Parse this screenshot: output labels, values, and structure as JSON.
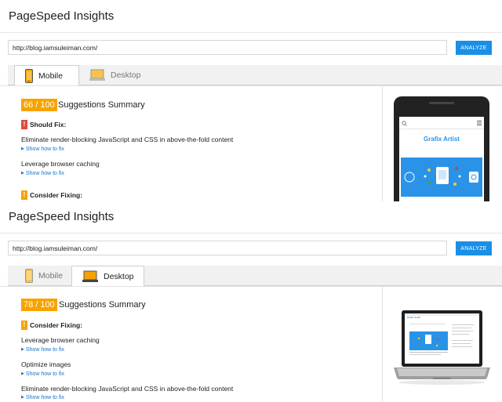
{
  "panels": [
    {
      "title": "PageSpeed Insights",
      "url_value": "http://blog.iamsuleiman.com/",
      "analyze_label": "ANALYZE",
      "tabs": [
        {
          "label": "Mobile",
          "icon": "mobile-icon",
          "active": true
        },
        {
          "label": "Desktop",
          "icon": "desktop-icon",
          "active": false
        }
      ],
      "score": "66 / 100",
      "summary_title": "Suggestions Summary",
      "should_fix": {
        "heading": "Should Fix:",
        "flag_icon": "!",
        "color": "#dd4b39",
        "items": [
          {
            "title": "Eliminate render-blocking JavaScript and CSS in above-the-fold content",
            "link": "Show how to fix"
          },
          {
            "title": "Leverage browser caching",
            "link": "Show how to fix"
          }
        ]
      },
      "consider_fixing": {
        "heading": "Consider Fixing:",
        "flag_icon": "!",
        "color": "#f6a300"
      },
      "preview": {
        "site_title": "Grafix Artist",
        "device": "phone"
      }
    },
    {
      "title": "PageSpeed Insights",
      "url_value": "http://blog.iamsuleiman.com/",
      "analyze_label": "ANALYZE",
      "tabs": [
        {
          "label": "Mobile",
          "icon": "mobile-icon",
          "active": false
        },
        {
          "label": "Desktop",
          "icon": "desktop-icon",
          "active": true
        }
      ],
      "score": "78 / 100",
      "summary_title": "Suggestions Summary",
      "consider_fixing": {
        "heading": "Consider Fixing:",
        "flag_icon": "!",
        "color": "#f6a300",
        "items": [
          {
            "title": "Leverage browser caching",
            "link": "Show how to fix"
          },
          {
            "title": "Optimize images",
            "link": "Show how to fix"
          },
          {
            "title": "Eliminate render-blocking JavaScript and CSS in above-the-fold content",
            "link": "Show how to fix"
          }
        ]
      },
      "preview": {
        "site_title": "Grafix Artist",
        "device": "laptop"
      }
    }
  ],
  "colors": {
    "accent": "#1a8fe6",
    "score": "#f6a300",
    "should_fix": "#dd4b39",
    "link": "#1a73c9"
  }
}
